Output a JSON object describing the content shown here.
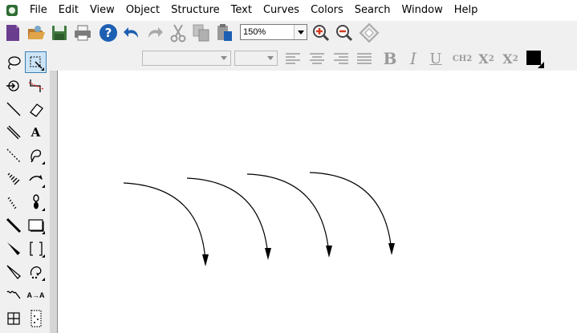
{
  "menu": {
    "items": [
      "File",
      "Edit",
      "View",
      "Object",
      "Structure",
      "Text",
      "Curves",
      "Colors",
      "Search",
      "Window",
      "Help"
    ]
  },
  "toolbar": {
    "zoom_value": "150%",
    "icons": [
      "new-document-icon",
      "open-icon",
      "save-icon",
      "print-icon",
      "help-icon",
      "undo-icon",
      "redo-icon",
      "cut-icon",
      "copy-icon",
      "paste-icon",
      "zoom-in-icon",
      "zoom-out-icon",
      "fit-window-icon"
    ]
  },
  "format_toolbar": {
    "font_value": "",
    "size_value": "",
    "bold_label": "B",
    "italic_label": "I",
    "underline_label": "U",
    "formula_label": "CH2",
    "subscript_label": "X",
    "subscript_sub": "2",
    "superscript_label": "X",
    "superscript_sup": "2",
    "text_color": "#000000"
  },
  "palette": {
    "text_tool_label": "A",
    "replace_tool_label": "A→A",
    "selected_tool": "marquee-tool"
  },
  "canvas": {
    "background": "#ffffff",
    "arrow_count": 4
  }
}
